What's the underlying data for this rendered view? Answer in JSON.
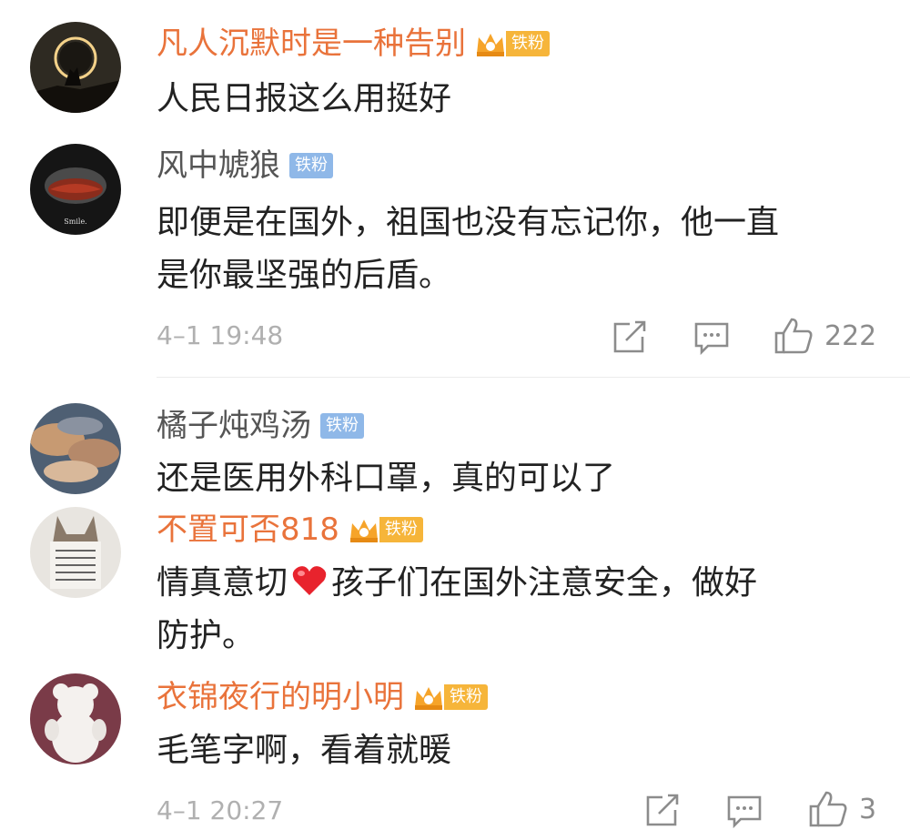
{
  "comments": [
    {
      "username": "凡人沉默时是一种告别",
      "badge": "铁粉",
      "text": "人民日报这么用挺好"
    },
    {
      "username": "风中虓狼",
      "badge": "铁粉",
      "text_line1": "即便是在国外，祖国也没有忘记你，他一直",
      "text_line2": "是你最坚强的后盾。",
      "timestamp": "4–1 19:48",
      "like_count": "222"
    },
    {
      "username": "橘子炖鸡汤",
      "badge": "铁粉",
      "text": "还是医用外科口罩，真的可以了"
    },
    {
      "username": "不置可否818",
      "badge": "铁粉",
      "text_part1": "情真意切",
      "text_part2": "孩子们在国外注意安全，做好",
      "text_line2": "防护。"
    },
    {
      "username": "衣锦夜行的明小明",
      "badge": "铁粉",
      "text": "毛笔字啊，看着就暖",
      "timestamp": "4–1 20:27",
      "like_count": "3"
    }
  ],
  "icons": [
    "share-icon",
    "comment-icon",
    "like-icon",
    "heart-emoji-icon",
    "crown-icon"
  ],
  "colors": {
    "vip_name": "#e9733b",
    "normal_name": "#555555",
    "fan_badge_blue": "#8fb8e8",
    "fan_badge_gold": "#f6b53a",
    "meta_grey": "#b0b0b0"
  }
}
